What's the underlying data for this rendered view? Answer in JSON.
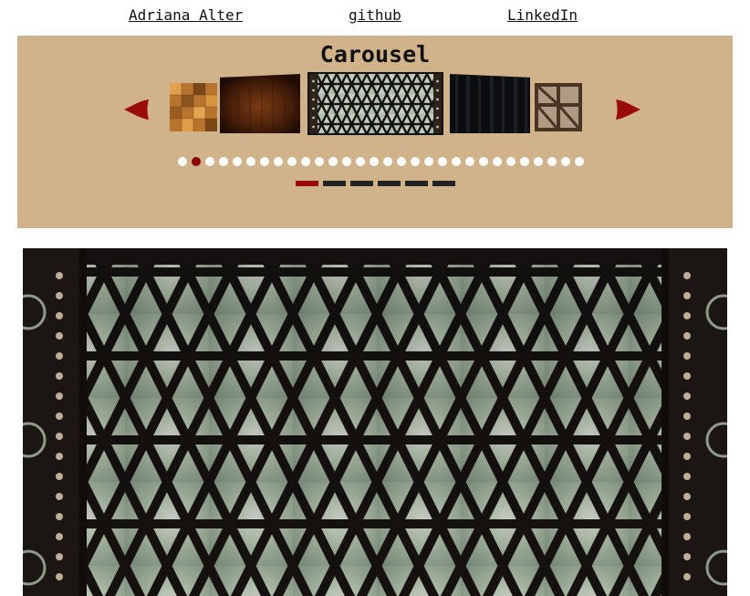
{
  "nav": {
    "author": "Adriana Alter",
    "github": "github",
    "linkedin": "LinkedIn"
  },
  "carousel": {
    "title": "Carousel",
    "dot_count": 30,
    "active_dot": 1,
    "bar_count": 6,
    "active_bar": 0,
    "thumbnails": [
      {
        "subject": "parquet-wood-floor"
      },
      {
        "subject": "dark-wood-panel"
      },
      {
        "subject": "stained-glass-window"
      },
      {
        "subject": "black-curtain"
      },
      {
        "subject": "timber-frame-wall"
      }
    ],
    "active_thumbnail": 2
  },
  "main_image": {
    "subject": "stained-glass-window"
  },
  "colors": {
    "panel_bg": "#d0b38a",
    "accent": "#8b0000",
    "bar": "#222222",
    "dot": "#ffffff"
  },
  "icons": {
    "prev": "arrow-left-icon",
    "next": "arrow-right-icon"
  }
}
